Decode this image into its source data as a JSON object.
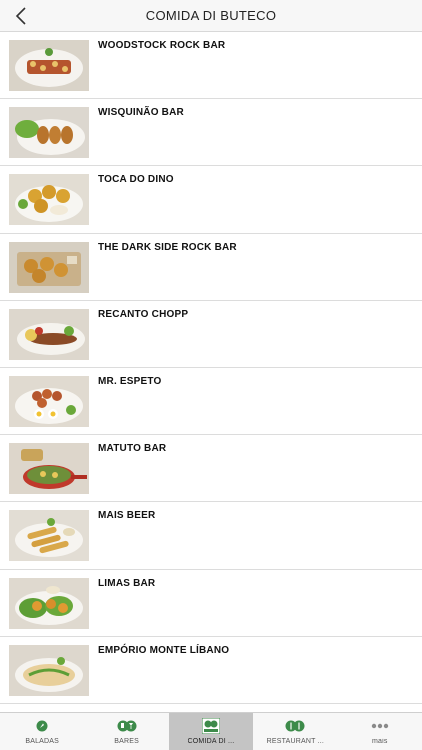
{
  "header": {
    "title": "COMIDA DI BUTECO",
    "back_icon": "chevron-left-icon"
  },
  "list": {
    "items": [
      {
        "name": "WOODSTOCK ROCK BAR",
        "thumb": "skewers-on-plate"
      },
      {
        "name": "WISQUINÃO BAR",
        "thumb": "croquettes-with-lettuce"
      },
      {
        "name": "TOCA DO DINO",
        "thumb": "fried-balls-with-dip"
      },
      {
        "name": "THE DARK SIDE ROCK BAR",
        "thumb": "pastries-on-board"
      },
      {
        "name": "RECANTO CHOPP",
        "thumb": "sausage-with-salad"
      },
      {
        "name": "MR. ESPETO",
        "thumb": "fried-bites-with-eggs"
      },
      {
        "name": "MATUTO BAR",
        "thumb": "pan-with-stew"
      },
      {
        "name": "MAIS BEER",
        "thumb": "rolls-with-sauce"
      },
      {
        "name": "LIMAS BAR",
        "thumb": "fried-fish-with-lettuce"
      },
      {
        "name": "EMPÓRIO MONTE LÍBANO",
        "thumb": "flatbread-with-herbs"
      }
    ]
  },
  "tabbar": {
    "tabs": [
      {
        "label": "BALADAS",
        "icon": "baladas-icon",
        "active": false
      },
      {
        "label": "BARES",
        "icon": "bares-icon",
        "active": false
      },
      {
        "label": "COMIDA DI ...",
        "icon": "comida-di-buteco-icon",
        "active": true
      },
      {
        "label": "RESTAURANT ...",
        "icon": "restaurantes-icon",
        "active": false
      },
      {
        "label": "mais",
        "icon": "more-dots-icon",
        "active": false
      }
    ]
  },
  "colors": {
    "accent_green": "#3d8b4a",
    "active_tab_bg": "#c4c4c4"
  }
}
